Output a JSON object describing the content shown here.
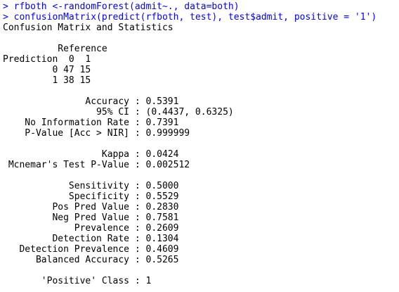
{
  "commands": [
    "> rfboth <-randomForest(admit~., data=both)",
    "> confusionMatrix(predict(rfboth, test), test$admit, positive = '1')"
  ],
  "output": {
    "title": "Confusion Matrix and Statistics",
    "reference_header": "          Reference",
    "prediction_header": "Prediction  0  1",
    "row0": "         0 47 15",
    "row1": "         1 38 15",
    "accuracy": "               Accuracy : 0.5391",
    "ci": "                 95% CI : (0.4437, 0.6325)",
    "nir": "    No Information Rate : 0.7391",
    "pvalue": "    P-Value [Acc > NIR] : 0.999999",
    "kappa": "                  Kappa : 0.0424",
    "mcnemar": " Mcnemar's Test P-Value : 0.002512",
    "sensitivity": "            Sensitivity : 0.5000",
    "specificity": "            Specificity : 0.5529",
    "ppv": "         Pos Pred Value : 0.2830",
    "npv": "         Neg Pred Value : 0.7581",
    "prevalence": "             Prevalence : 0.2609",
    "detection_rate": "         Detection Rate : 0.1304",
    "detection_prevalence": "   Detection Prevalence : 0.4609",
    "balanced_accuracy": "      Balanced Accuracy : 0.5265",
    "positive_class": "       'Positive' Class : 1"
  },
  "colors": {
    "command": "#0000ff",
    "output": "#000000",
    "background": "#ffffff"
  }
}
